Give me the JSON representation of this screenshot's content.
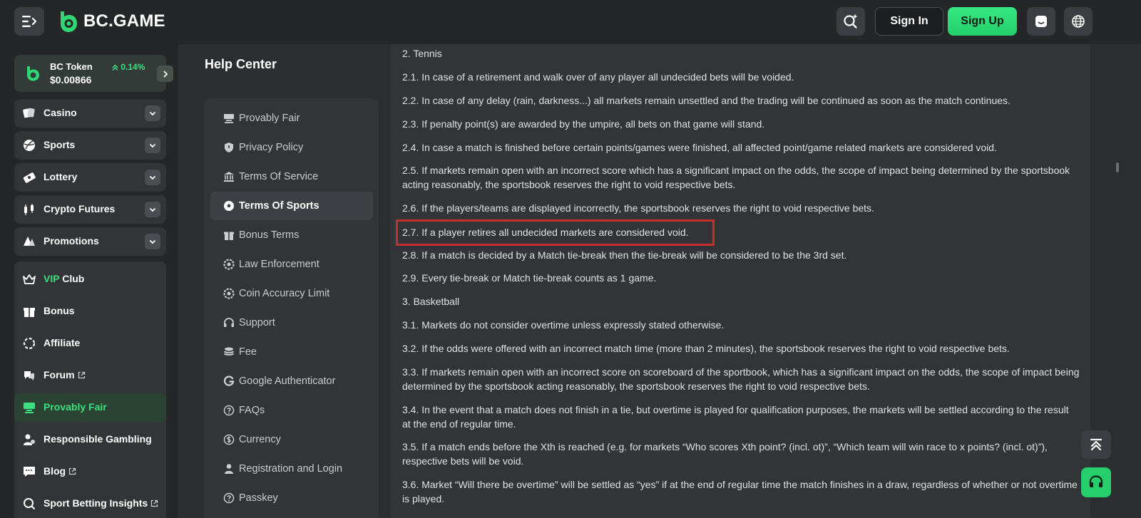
{
  "header": {
    "logo_text": "BC.GAME",
    "sign_in": "Sign In",
    "sign_up": "Sign Up"
  },
  "token": {
    "name": "BC Token",
    "change": "0.14%",
    "price": "$0.00866"
  },
  "sidebar": {
    "groups": [
      {
        "label": "Casino",
        "icon": "casino-icon"
      },
      {
        "label": "Sports",
        "icon": "sports-ball-icon"
      },
      {
        "label": "Lottery",
        "icon": "lottery-ticket-icon"
      },
      {
        "label": "Crypto Futures",
        "icon": "candlestick-icon"
      },
      {
        "label": "Promotions",
        "icon": "promotions-icon"
      }
    ],
    "vip_prefix": "VIP",
    "vip_suffix": "Club",
    "items": [
      {
        "label": "Bonus",
        "icon": "gift-icon"
      },
      {
        "label": "Affiliate",
        "icon": "affiliate-icon"
      },
      {
        "label": "Forum",
        "icon": "forum-icon"
      },
      {
        "label": "Provably Fair",
        "icon": "provably-fair-icon"
      },
      {
        "label": "Responsible Gambling",
        "icon": "responsible-gambling-icon"
      },
      {
        "label": "Blog",
        "icon": "blog-icon"
      },
      {
        "label": "Sport Betting Insights",
        "icon": "insights-icon"
      }
    ]
  },
  "help": {
    "title": "Help Center",
    "menu": [
      {
        "label": "Provably Fair",
        "icon": "provably-fair-icon"
      },
      {
        "label": "Privacy Policy",
        "icon": "shield-icon"
      },
      {
        "label": "Terms Of Service",
        "icon": "bank-icon"
      },
      {
        "label": "Terms Of Sports",
        "icon": "soccer-ball-icon"
      },
      {
        "label": "Bonus Terms",
        "icon": "gift-icon"
      },
      {
        "label": "Law Enforcement",
        "icon": "badge-icon"
      },
      {
        "label": "Coin Accuracy Limit",
        "icon": "coin-icon"
      },
      {
        "label": "Support",
        "icon": "headset-icon"
      },
      {
        "label": "Fee",
        "icon": "coins-stack-icon"
      },
      {
        "label": "Google Authenticator",
        "icon": "google-icon"
      },
      {
        "label": "FAQs",
        "icon": "question-icon"
      },
      {
        "label": "Currency",
        "icon": "dollar-icon"
      },
      {
        "label": "Registration and Login",
        "icon": "user-icon"
      },
      {
        "label": "Passkey",
        "icon": "question-icon"
      }
    ]
  },
  "content": {
    "paragraphs": [
      "2. Tennis",
      "2.1. In case of a retirement and walk over of any player all undecided bets will be voided.",
      "2.2. In case of any delay (rain, darkness...) all markets remain unsettled and the trading will be continued as soon as the match continues.",
      "2.3. If penalty point(s) are awarded by the umpire, all bets on that game will stand.",
      "2.4. In case a match is finished before certain points/games were finished, all affected point/game related markets are considered void.",
      "2.5. If markets remain open with an incorrect score which has a significant impact on the odds, the scope of impact being determined by the sportsbook acting reasonably, the sportsbook reserves the right to void respective bets.",
      "2.6. If the players/teams are displayed incorrectly, the sportsbook reserves the right to void respective bets.",
      "2.7. If a player retires all undecided markets are considered void.",
      "2.8. If a match is decided by a Match tie-break then the tie-break will be considered to be the 3rd set.",
      "2.9. Every tie-break or Match tie-break counts as 1 game.",
      "3. Basketball",
      "3.1. Markets do not consider overtime unless expressly stated otherwise.",
      "3.2. If the odds were offered with an incorrect match time (more than 2 minutes), the sportsbook reserves the right to void respective bets.",
      "3.3. If markets remain open with an incorrect score on scoreboard of the sportbook, which has a significant impact on the odds, the scope of impact being determined by the sportsbook acting reasonably, the sportsbook reserves the right to void respective bets.",
      "3.4. In the event that a match does not finish in a tie, but overtime is played for qualification purposes, the markets will be settled according to the result at the end of regular time.",
      "3.5. If a match ends before the Xth is reached (e.g. for markets “Who scores Xth point? (incl. ot)”, “Which team will win race to x points? (incl. ot)”), respective bets will be void.",
      "3.6. Market “Will there be overtime” will be settled as “yes” if at the end of regular time the match finishes in a draw, regardless of whether or not overtime is played."
    ]
  },
  "colors": {
    "accent": "#3bdf7f",
    "highlight": "#c72f2f",
    "background": "#2b2e31"
  }
}
